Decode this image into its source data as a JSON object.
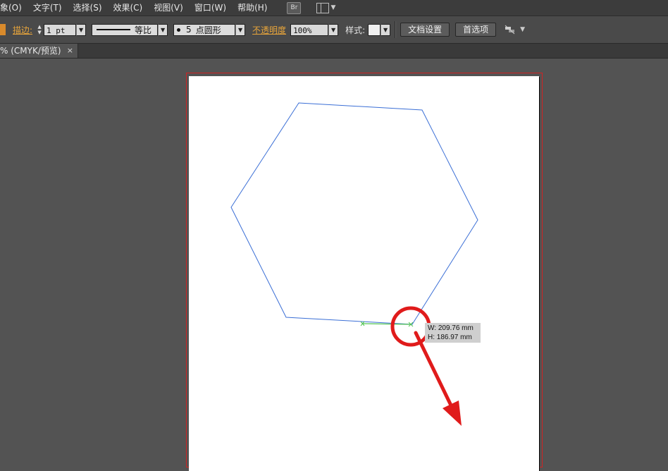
{
  "menubar": {
    "items": [
      "象(O)",
      "文字(T)",
      "选择(S)",
      "效果(C)",
      "视图(V)",
      "窗口(W)",
      "帮助(H)"
    ],
    "bridge_label": "Br"
  },
  "control": {
    "stroke_label": "描边:",
    "stroke_weight": "1 pt",
    "stroke_profile": "等比",
    "brush_size": "5",
    "brush_name": "点圆形",
    "opacity_label": "不透明度",
    "opacity_value": "100%",
    "style_label": "样式:",
    "doc_setup": "文档设置",
    "preferences": "首选项"
  },
  "tab": {
    "title": "% (CMYK/预览)",
    "close": "×"
  },
  "tooltip": {
    "width": "W: 209.76 mm",
    "height": "H: 186.97 mm"
  },
  "colors": {
    "accent_orange": "#e8a53b",
    "path_blue": "#3b6fd6",
    "smart_guide_green": "#52c452",
    "annotation_red": "#e01b1b"
  }
}
